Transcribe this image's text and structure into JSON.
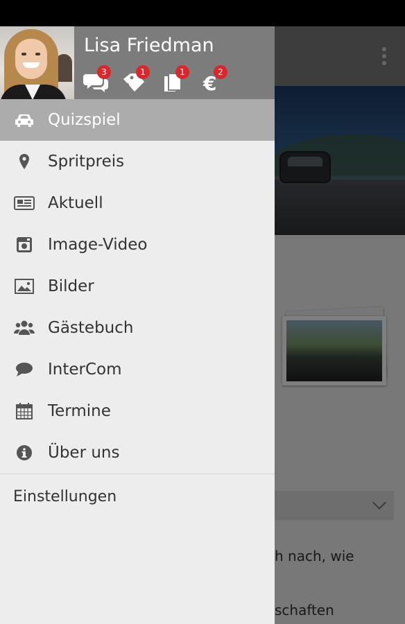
{
  "user": {
    "name": "Lisa Friedman",
    "badges": [
      {
        "icon": "chat-bubbles-icon",
        "count": "3"
      },
      {
        "icon": "tags-icon",
        "count": "1"
      },
      {
        "icon": "documents-icon",
        "count": "1"
      },
      {
        "icon": "euro-icon",
        "count": "2"
      }
    ]
  },
  "menu": {
    "items": [
      {
        "label": "Quizspiel",
        "icon": "car-icon",
        "active": true
      },
      {
        "label": "Spritpreis",
        "icon": "map-pin-icon"
      },
      {
        "label": "Aktuell",
        "icon": "newspaper-icon"
      },
      {
        "label": "Image-Video",
        "icon": "instagram-camera-icon"
      },
      {
        "label": "Bilder",
        "icon": "picture-icon"
      },
      {
        "label": "Gästebuch",
        "icon": "users-group-icon"
      },
      {
        "label": "InterCom",
        "icon": "speech-bubble-icon"
      },
      {
        "label": "Termine",
        "icon": "calendar-icon"
      },
      {
        "label": "Über uns",
        "icon": "info-icon"
      }
    ],
    "settings_label": "Einstellungen"
  },
  "background": {
    "text_line_1": "h nach, wie",
    "text_line_2": "schaften"
  },
  "colors": {
    "drawer_bg": "#ededed",
    "header_bg": "#7c7c7c",
    "active_item_bg": "#acacac",
    "badge": "#d8282d"
  }
}
